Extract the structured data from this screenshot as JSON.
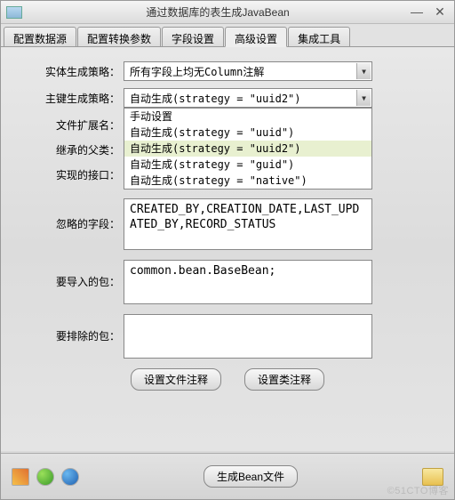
{
  "window": {
    "title": "通过数据库的表生成JavaBean"
  },
  "tabs": [
    "配置数据源",
    "配置转换参数",
    "字段设置",
    "高级设置",
    "集成工具"
  ],
  "labels": {
    "entityStrategy": "实体生成策略：",
    "pkStrategy": "主键生成策略：",
    "fileExt": "文件扩展名：",
    "parentClass": "继承的父类：",
    "interfaces": "实现的接口：",
    "ignoreFields": "忽略的字段：",
    "importPkg": "要导入的包：",
    "excludePkg": "要排除的包："
  },
  "entityStrategy": {
    "value": "所有字段上均无Column注解"
  },
  "pkStrategy": {
    "value": "自动生成(strategy = \"uuid2\")",
    "options": [
      "手动设置",
      "自动生成(strategy = \"uuid\")",
      "自动生成(strategy = \"uuid2\")",
      "自动生成(strategy = \"guid\")",
      "自动生成(strategy = \"native\")"
    ]
  },
  "ignoreFields": "CREATED_BY,CREATION_DATE,LAST_UPDATED_BY,RECORD_STATUS",
  "importPkg": "common.bean.BaseBean;",
  "excludePkg": "",
  "buttons": {
    "fileComment": "设置文件注释",
    "classComment": "设置类注释",
    "generate": "生成Bean文件"
  },
  "watermark": "©51CTO博客"
}
